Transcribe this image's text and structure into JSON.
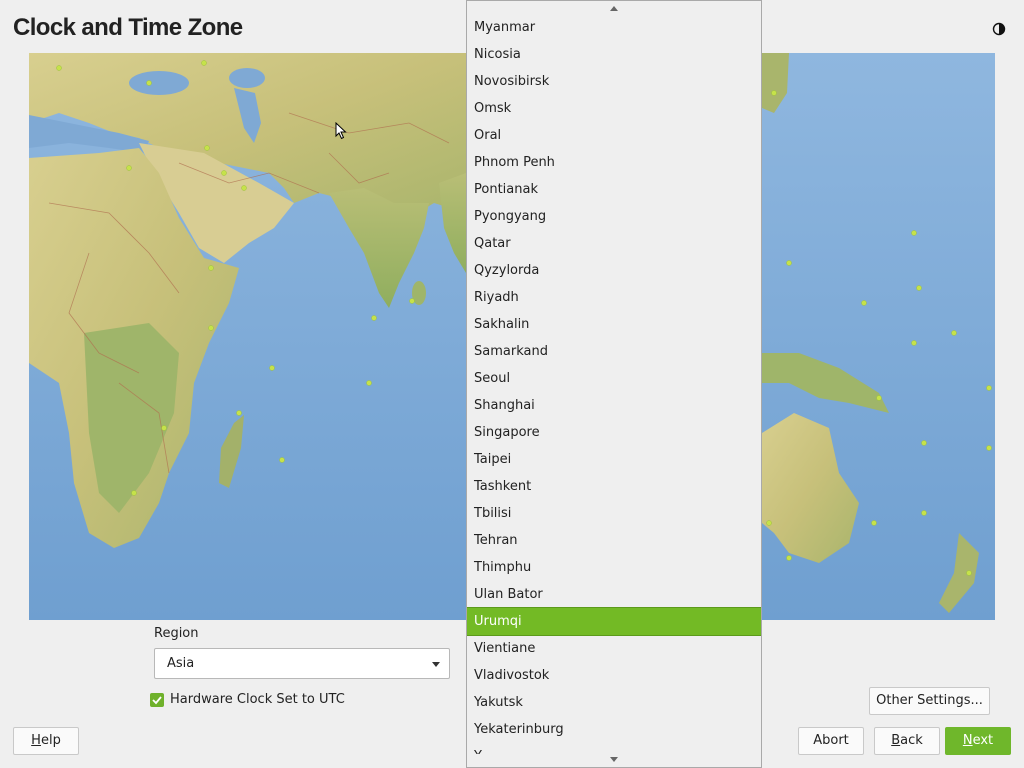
{
  "title": "Clock and Time Zone",
  "icons": {
    "theme": "half-moon-icon",
    "checkbox": "checkmark-icon",
    "scroll_up": "chevron-up-icon",
    "scroll_down": "chevron-down-icon",
    "dropdown": "chevron-down-icon"
  },
  "region": {
    "label": "Region",
    "value": "Asia"
  },
  "hardware_clock": {
    "label": "Hardware Clock Set to UTC",
    "checked": true
  },
  "timezone_list": {
    "items": [
      "Myanmar",
      "Nicosia",
      "Novosibirsk",
      "Omsk",
      "Oral",
      "Phnom Penh",
      "Pontianak",
      "Pyongyang",
      "Qatar",
      "Qyzylorda",
      "Riyadh",
      "Sakhalin",
      "Samarkand",
      "Seoul",
      "Shanghai",
      "Singapore",
      "Taipei",
      "Tashkent",
      "Tbilisi",
      "Tehran",
      "Thimphu",
      "Ulan Bator",
      "Urumqi",
      "Vientiane",
      "Vladivostok",
      "Yakutsk",
      "Yekaterinburg",
      "Y"
    ],
    "selected": "Urumqi"
  },
  "buttons": {
    "other_settings": "Other Settings...",
    "help": "Help",
    "abort": "Abort",
    "back": "Back",
    "next": "Next"
  },
  "colors": {
    "accent": "#73ba25",
    "ocean": "#7ca9d6",
    "land": "#c8c27a"
  }
}
